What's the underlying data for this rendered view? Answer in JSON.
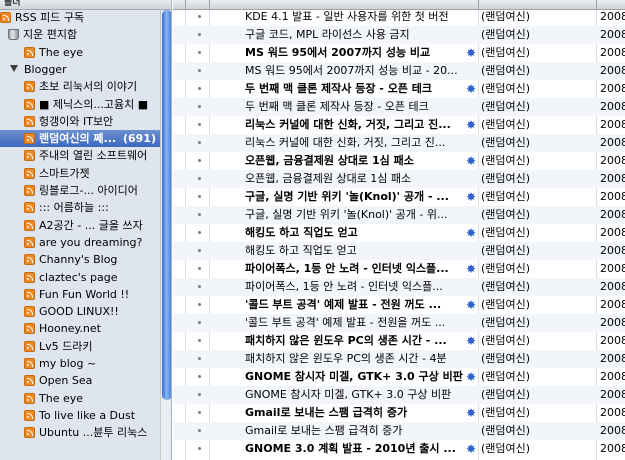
{
  "sidebar": {
    "header": "폴더",
    "items": [
      {
        "label": "RSS 피드 구독",
        "icon": "rss-icon",
        "indent": 0,
        "tri": false
      },
      {
        "label": "지운 편지함",
        "icon": "trash-icon",
        "indent": 1,
        "tri": false
      },
      {
        "label": "The eye",
        "icon": "rss-icon",
        "indent": 2,
        "tri": false
      },
      {
        "label": "Blogger",
        "icon": "folder-icon",
        "indent": 1,
        "tri": true
      },
      {
        "label": "초보 리눅서의 이야기",
        "icon": "rss-icon",
        "indent": 2,
        "tri": false
      },
      {
        "label": "■ 제닉스의...고윰치 ■",
        "icon": "rss-icon",
        "indent": 2,
        "tri": false
      },
      {
        "label": "헝갱이와 IT보안",
        "icon": "rss-icon",
        "indent": 2,
        "tri": false
      },
      {
        "label": "랜덤여신의 쩨...",
        "count": "(691)",
        "icon": "rss-icon",
        "indent": 2,
        "tri": false,
        "selected": true
      },
      {
        "label": "주내의 열린 소프트웨어",
        "icon": "rss-icon",
        "indent": 2,
        "tri": false
      },
      {
        "label": "스마트가젯",
        "icon": "rss-icon",
        "indent": 2,
        "tri": false
      },
      {
        "label": "링블로그-... 아이디어",
        "icon": "rss-icon",
        "indent": 2,
        "tri": false
      },
      {
        "label": "::: 어름하늘 :::",
        "icon": "rss-icon",
        "indent": 2,
        "tri": false
      },
      {
        "label": "A2공간 - ... 글을 쓰자",
        "icon": "rss-icon",
        "indent": 2,
        "tri": false
      },
      {
        "label": "are you dreaming?",
        "icon": "rss-icon",
        "indent": 2,
        "tri": false
      },
      {
        "label": "Channy's Blog",
        "icon": "rss-icon",
        "indent": 2,
        "tri": false
      },
      {
        "label": "claztec's page",
        "icon": "rss-icon",
        "indent": 2,
        "tri": false
      },
      {
        "label": "Fun Fun World !!",
        "icon": "rss-icon",
        "indent": 2,
        "tri": false
      },
      {
        "label": "GOOD LINUX!!",
        "icon": "rss-icon",
        "indent": 2,
        "tri": false
      },
      {
        "label": "Hooney.net",
        "icon": "rss-icon",
        "indent": 2,
        "tri": false
      },
      {
        "label": "Lv5 드라키",
        "icon": "rss-icon",
        "indent": 2,
        "tri": false
      },
      {
        "label": "my blog ~",
        "icon": "rss-icon",
        "indent": 2,
        "tri": false
      },
      {
        "label": "Open Sea",
        "icon": "rss-icon",
        "indent": 2,
        "tri": false
      },
      {
        "label": "The eye",
        "icon": "rss-icon",
        "indent": 2,
        "tri": false
      },
      {
        "label": "To live like a Dust",
        "icon": "rss-icon",
        "indent": 2,
        "tri": false
      },
      {
        "label": "Ubuntu ...뷴투 리눅스",
        "icon": "rss-icon",
        "indent": 2,
        "tri": false
      }
    ]
  },
  "messages": [
    {
      "title": "KDE 4.1 발표 - 일반 사용자를 위한 첫 버전",
      "author": "(랜덤여신)",
      "date": "2008",
      "unread": false,
      "star": false
    },
    {
      "title": "구글 코드, MPL 라이선스 사용 금지",
      "author": "(랜덤여신)",
      "date": "2008",
      "unread": false,
      "star": false
    },
    {
      "title": "MS 워드 95에서 2007까지 성능 비교",
      "author": "(랜덤여신)",
      "date": "2008",
      "unread": true,
      "star": true
    },
    {
      "title": "MS 워드 95에서 2007까지 성능 비교 - 20...",
      "author": "(랜덤여신)",
      "date": "2008",
      "unread": false,
      "star": false
    },
    {
      "title": "두 번째 맥 클론 제작사 등장 - 오픈 테크",
      "author": "(랜덤여신)",
      "date": "2008",
      "unread": true,
      "star": true
    },
    {
      "title": "두 번째 맥 클론 제작사 등장 - 오픈 테크",
      "author": "(랜덤여신)",
      "date": "2008",
      "unread": false,
      "star": false
    },
    {
      "title": "리눅스 커널에 대한 신화, 거짓, 그리고 진...",
      "author": "(랜덤여신)",
      "date": "2008",
      "unread": true,
      "star": true
    },
    {
      "title": "리눅스 커널에 대한 신화, 거짓, 그리고 진...",
      "author": "(랜덤여신)",
      "date": "2008",
      "unread": false,
      "star": false
    },
    {
      "title": "오픈웹, 금융결제원 상대로 1심 패소",
      "author": "(랜덤여신)",
      "date": "2008",
      "unread": true,
      "star": true
    },
    {
      "title": "오픈웹, 금융결제원 상대로 1심 패소",
      "author": "(랜덤여신)",
      "date": "2008",
      "unread": false,
      "star": false
    },
    {
      "title": "구글, 실명 기반 위키 '놀(Knol)' 공개 - ...",
      "author": "(랜덤여신)",
      "date": "2008",
      "unread": true,
      "star": true
    },
    {
      "title": "구글, 실명 기반 위키 '놀(Knol)' 공개 - 위...",
      "author": "(랜덤여신)",
      "date": "2008",
      "unread": false,
      "star": false
    },
    {
      "title": "해킹도 하고 직업도 얻고",
      "author": "(랜덤여신)",
      "date": "2008",
      "unread": true,
      "star": true
    },
    {
      "title": "해킹도 하고 직업도 얻고",
      "author": "(랜덤여신)",
      "date": "2008",
      "unread": false,
      "star": false
    },
    {
      "title": "파이어폭스, 1등 안 노려 - 인터넷 익스플...",
      "author": "(랜덤여신)",
      "date": "2008",
      "unread": true,
      "star": true
    },
    {
      "title": "파이어폭스, 1등 안 노려 - 인터넷 익스플...",
      "author": "(랜덤여신)",
      "date": "2008",
      "unread": false,
      "star": false
    },
    {
      "title": "'콜드 부트 공격' 예제 발표 - 전원 꺼도 ...",
      "author": "(랜덤여신)",
      "date": "2008",
      "unread": true,
      "star": true
    },
    {
      "title": "'콜드 부트 공격' 예제 발표 - 전원을 꺼도 ...",
      "author": "(랜덤여신)",
      "date": "2008",
      "unread": false,
      "star": false
    },
    {
      "title": "패치하지 않은 윈도우 PC의 생존 시간 - ...",
      "author": "(랜덤여신)",
      "date": "2008",
      "unread": true,
      "star": true
    },
    {
      "title": "패치하지 않은 윈도우 PC의 생존 시간 - 4분",
      "author": "(랜덤여신)",
      "date": "2008",
      "unread": false,
      "star": false
    },
    {
      "title": "GNOME 참시자 미겔, GTK+ 3.0 구상 비판",
      "author": "(랜덤여신)",
      "date": "2008",
      "unread": true,
      "star": true
    },
    {
      "title": "GNOME 참시자 미겔, GTK+ 3.0 구상 비판",
      "author": "(랜덤여신)",
      "date": "2008",
      "unread": false,
      "star": false
    },
    {
      "title": "Gmail로 보내는 스팸 급격히 증가",
      "author": "(랜덤여신)",
      "date": "2008",
      "unread": true,
      "star": true
    },
    {
      "title": "Gmail로 보내는 스팸 급격히 증가",
      "author": "(랜덤여신)",
      "date": "2008",
      "unread": false,
      "star": false
    },
    {
      "title": "GNOME 3.0 계획 발표 - 2010년 출시 ...",
      "author": "(랜덤여신)",
      "date": "2008",
      "unread": true,
      "star": true
    }
  ],
  "colors": {
    "selection": "#3d69bf",
    "star": "#2f5fd0",
    "rss": "#f08a24"
  }
}
